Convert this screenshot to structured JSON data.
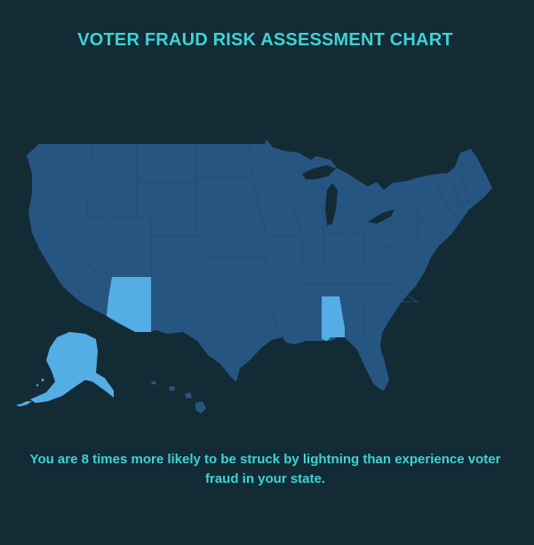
{
  "title": "VOTER FRAUD RISK ASSESSMENT CHART",
  "caption": "You are 8 times more likely to be struck by lightning than experience voter fraud in your state.",
  "colors": {
    "background": "#132b35",
    "text": "#3fd2d3",
    "state_default": "#275582",
    "state_highlight": "#55ade6",
    "state_border": "#234d6e"
  },
  "highlighted_states": [
    "Arizona",
    "Alabama",
    "Alaska"
  ]
}
